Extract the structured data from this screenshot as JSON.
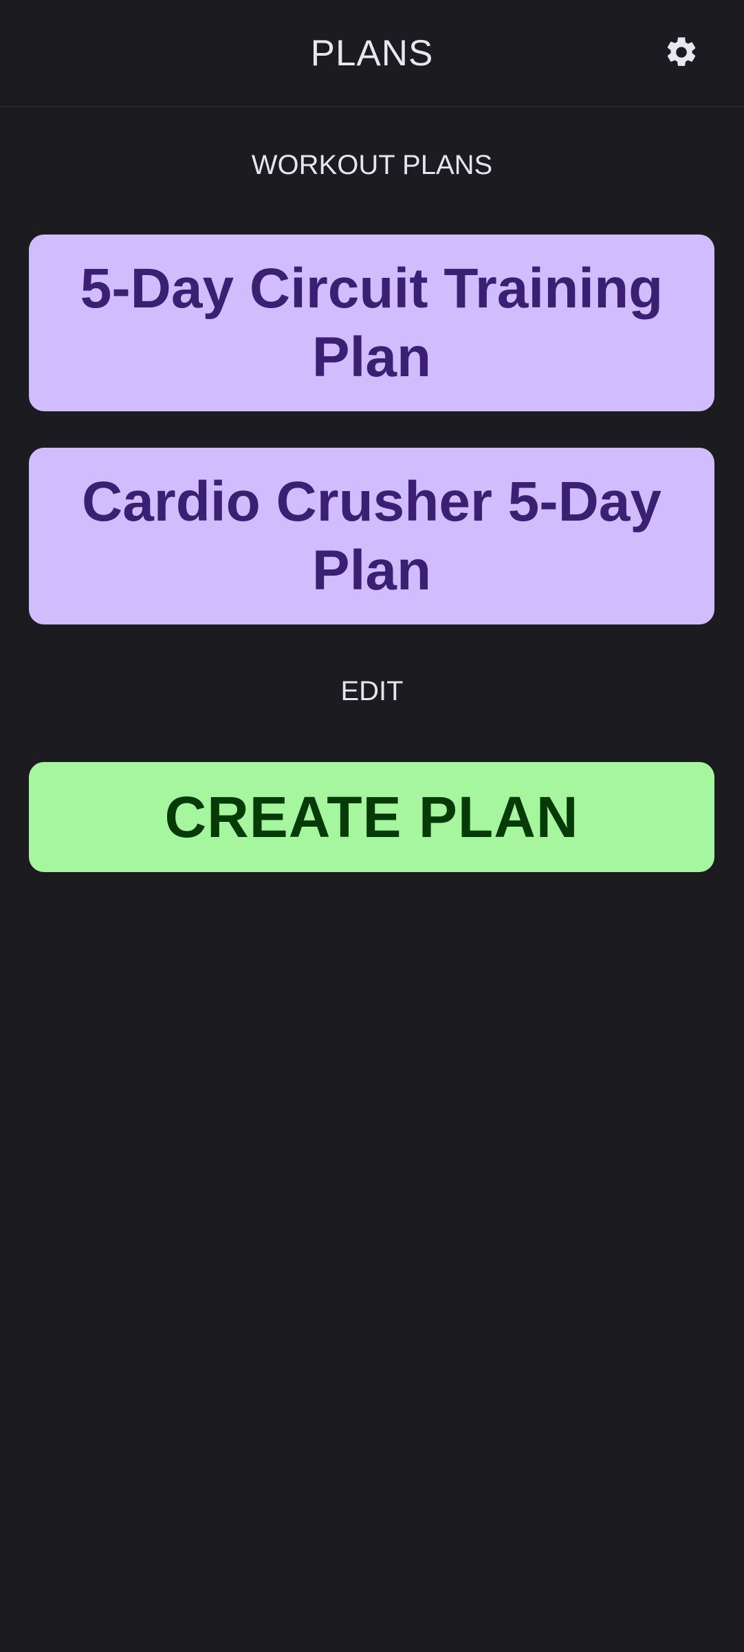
{
  "header": {
    "title": "PLANS",
    "settings_icon": "gear-icon"
  },
  "sections": {
    "workout_plans_label": "WORKOUT PLANS",
    "edit_label": "EDIT"
  },
  "plans": [
    {
      "name": "5-Day Circuit Training Plan"
    },
    {
      "name": "Cardio Crusher 5-Day Plan"
    }
  ],
  "actions": {
    "create_plan_label": "CREATE PLAN"
  },
  "colors": {
    "background": "#1c1b20",
    "plan_card": "#d1bcfd",
    "plan_text": "#3a1f73",
    "create_button": "#a6f6a0",
    "create_text": "#063a06",
    "text_light": "#e8e6ee"
  }
}
